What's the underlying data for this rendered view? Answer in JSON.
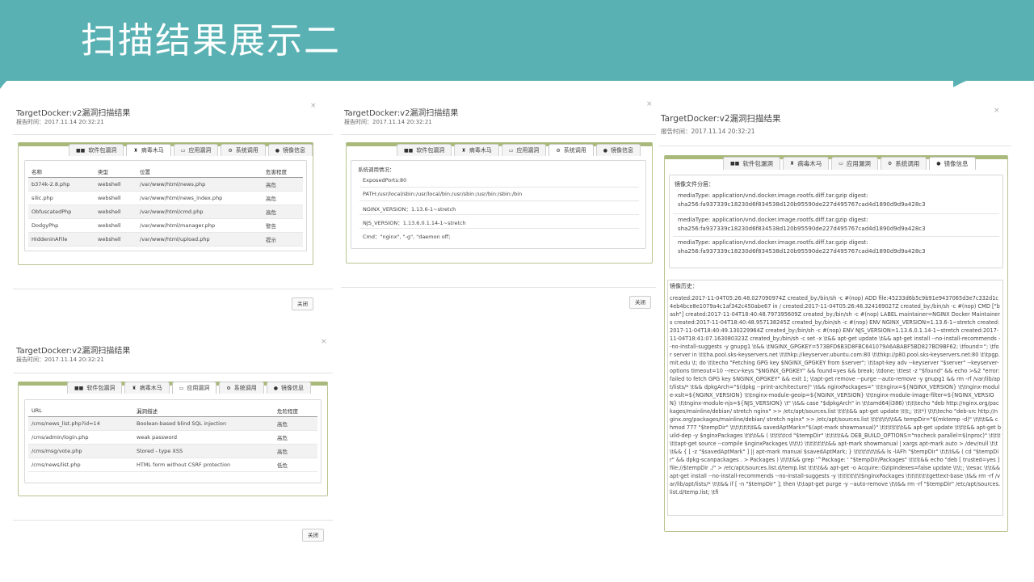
{
  "slide": {
    "title": "扫描结果展示二",
    "banner_color": "#5ab1b3"
  },
  "dialog_common": {
    "title": "TargetDocker:v2漏洞扫描结果",
    "report_time": "报告时间：2017.11.14 20:32:21",
    "close_x": "×",
    "close_button": "关闭"
  },
  "tabs": {
    "software": "软件包漏洞",
    "trojan": "病毒木马",
    "app": "应用漏洞",
    "syscall": "系统调用",
    "image": "镜像信息"
  },
  "trojan_table": {
    "headers": [
      "名称",
      "类型",
      "位置",
      "危害程度"
    ],
    "rows": [
      [
        "b374k-2.8.php",
        "webshell",
        "/var/www/html/news.php",
        "高危"
      ],
      [
        "silic.php",
        "webshell",
        "/var/www/html/news_index.php",
        "高危"
      ],
      [
        "ObfuscatedPhp",
        "webshell",
        "/var/www/html/cmd.php",
        "高危"
      ],
      [
        "DodgyPhp",
        "webshell",
        "/var/www/html/manager.php",
        "警告"
      ],
      [
        "HiddeninAFile",
        "webshell",
        "/var/www/html/upload.php",
        "提示"
      ]
    ]
  },
  "syscall": {
    "heading": "系统调用情况：",
    "lines": [
      "ExposedPorts:80",
      "PATH:/usr/local/sbin:/usr/local/bin:/usr/sbin:/usr/bin:/sbin:/bin",
      "NGINX_VERSION：1.13.6-1~stretch",
      "NJS_VERSION：1.13.6.0.1.14-1~stretch",
      "Cmd：\"nginx\", \"-g\", \"daemon off;"
    ]
  },
  "app_table": {
    "headers": [
      "URL",
      "漏洞描述",
      "危险程度"
    ],
    "rows": [
      [
        "/cms/news_list.php?id=14",
        "Boolean-based blind SQL injection",
        "高危"
      ],
      [
        "/cms/admin/login.php",
        "weak password",
        "高危"
      ],
      [
        "/cms/msg/vote.php",
        "Stored - type XSS",
        "高危"
      ],
      [
        "/cms/news/list.php",
        "HTML form without CSRF protection",
        "低危"
      ]
    ]
  },
  "image_info": {
    "layers_label": "镜像文件分层：",
    "layers": [
      "mediaType: application/vnd.docker.image.rootfs.diff.tar.gzip digest: sha256:fa937339c18230d6f834538d120b95590de227d495767cad4d1890d9d9a428c3",
      "mediaType: application/vnd.docker.image.rootfs.diff.tar.gzip digest: sha256:fa937339c18230d6f834538d120b95590de227d495767cad4d1890d9d9a428c3",
      "mediaType: application/vnd.docker.image.rootfs.diff.tar.gzip digest: sha256:fa937339c18230d6f834538d120b95590de227d495767cad4d1890d9d9a428c3"
    ],
    "history_label": "镜像历史：",
    "history": "created:2017-11-04T05:26:48.027090974Z created_by:/bin/sh -c #(nop) ADD file:45233d6b5c9b91e9437065d3e7c332d1c4eb4bce8e1079a4c1af342c450abe67 in / created:2017-11-04T05:26:48.324169027Z created_by:/bin/sh -c #(nop) CMD [\"bash\"] created:2017-11-04T18:40:48.797395609Z created_by:/bin/sh -c #(nop) LABEL maintainer=NGINX Docker Maintainers created:2017-11-04T18:40:48.957138245Z created_by:/bin/sh -c #(nop) ENV NGINX_VERSION=1.13.6-1~stretch created:2017-11-04T18:40:49.130229964Z created_by:/bin/sh -c #(nop) ENV NJS_VERSION=1.13.6.0.1.14-1~stretch created:2017-11-04T18:41:07.163080323Z created_by:/bin/sh -c set -x \\t&& apt-get update \\t&& apt-get install --no-install-recommends --no-install-suggests -y gnupg1 \\t&& \\tNGINX_GPGKEY=573BFD6B3D8FBC641079A6ABABF5BD827BD9BF62; \\tfound=''; \\tfor server in \\t\\tha.pool.sks-keyservers.net \\t\\thkp://keyserver.ubuntu.com:80 \\t\\thkp://p80.pool.sks-keyservers.net:80 \\t\\tpgp.mit.edu \\t; do \\t\\techo \"Fetching GPG key $NGINX_GPGKEY from $server\"; \\t\\tapt-key adv --keyserver \"$server\" --keyserver-options timeout=10 --recv-keys \"$NGINX_GPGKEY\" && found=yes && break; \\tdone; \\ttest -z \"$found\" && echo >&2 \"error: failed to fetch GPG key $NGINX_GPGKEY\" && exit 1; \\tapt-get remove --purge --auto-remove -y gnupg1 && rm -rf /var/lib/apt/lists/* \\t&& dpkgArch=\"$(dpkg --print-architecture)\" \\t&& nginxPackages=\" \\t\\tnginx=${NGINX_VERSION} \\t\\tnginx-module-xslt=${NGINX_VERSION} \\t\\tnginx-module-geoip=${NGINX_VERSION} \\t\\tnginx-module-image-filter=${NGINX_VERSION} \\t\\tnginx-module-njs=${NJS_VERSION} \\t\" \\t&& case \"$dpkgArch\" in \\t\\tamd64|i386) \\t\\t\\techo \"deb http://nginx.org/packages/mainline/debian/ stretch nginx\" >> /etc/apt/sources.list \\t\\t\\t&& apt-get update \\t\\t;; \\t\\t*) \\t\\t\\techo \"deb-src http://nginx.org/packages/mainline/debian/ stretch nginx\" >> /etc/apt/sources.list \\t\\t\\t\\t\\t\\t&& tempDir=\"$(mktemp -d)\" \\t\\t\\t&& chmod 777 \"$tempDir\" \\t\\t\\t\\t\\t\\t&& savedAptMark=\"$(apt-mark showmanual)\" \\t\\t\\t\\t\\t\\t&& apt-get update \\t\\t\\t&& apt-get build-dep -y $nginxPackages \\t\\t\\t&& ( \\t\\t\\t\\tcd \"$tempDir\" \\t\\t\\t\\t&& DEB_BUILD_OPTIONS=\"nocheck parallel=$(nproc)\" \\t\\t\\t\\t\\tapt-get source --compile $nginxPackages \\t\\t\\t) \\t\\t\\t\\t\\t\\t&& apt-mark showmanual | xargs apt-mark auto > /dev/null \\t\\t\\t&& { [ -z \"$savedAptMark\" ] || apt-mark manual $savedAptMark; } \\t\\t\\t\\t\\t\\t&& ls -lAFh \"$tempDir\" \\t\\t\\t&& ( cd \"$tempDir\" && dpkg-scanpackages . > Packages ) \\t\\t\\t&& grep '^Package: ' \"$tempDir/Packages\" \\t\\t\\t&& echo \"deb [ trusted=yes ] file://$tempDir ./\" > /etc/apt/sources.list.d/temp.list \\t\\t\\t&& apt-get -o Acquire::GzipIndexes=false update \\t\\t;; \\tesac \\t\\t&& apt-get install --no-install-recommends --no-install-suggests -y \\t\\t\\t\\t\\t\\t$nginxPackages \\t\\t\\t\\t\\t\\tgettext-base \\t&& rm -rf /var/lib/apt/lists/* \\t\\t&& if [ -n \"$tempDir\" ]; then \\t\\tapt-get purge -y --auto-remove \\t\\t&& rm -rf \"$tempDir\" /etc/apt/sources.list.d/temp.list; \\tfi"
  }
}
